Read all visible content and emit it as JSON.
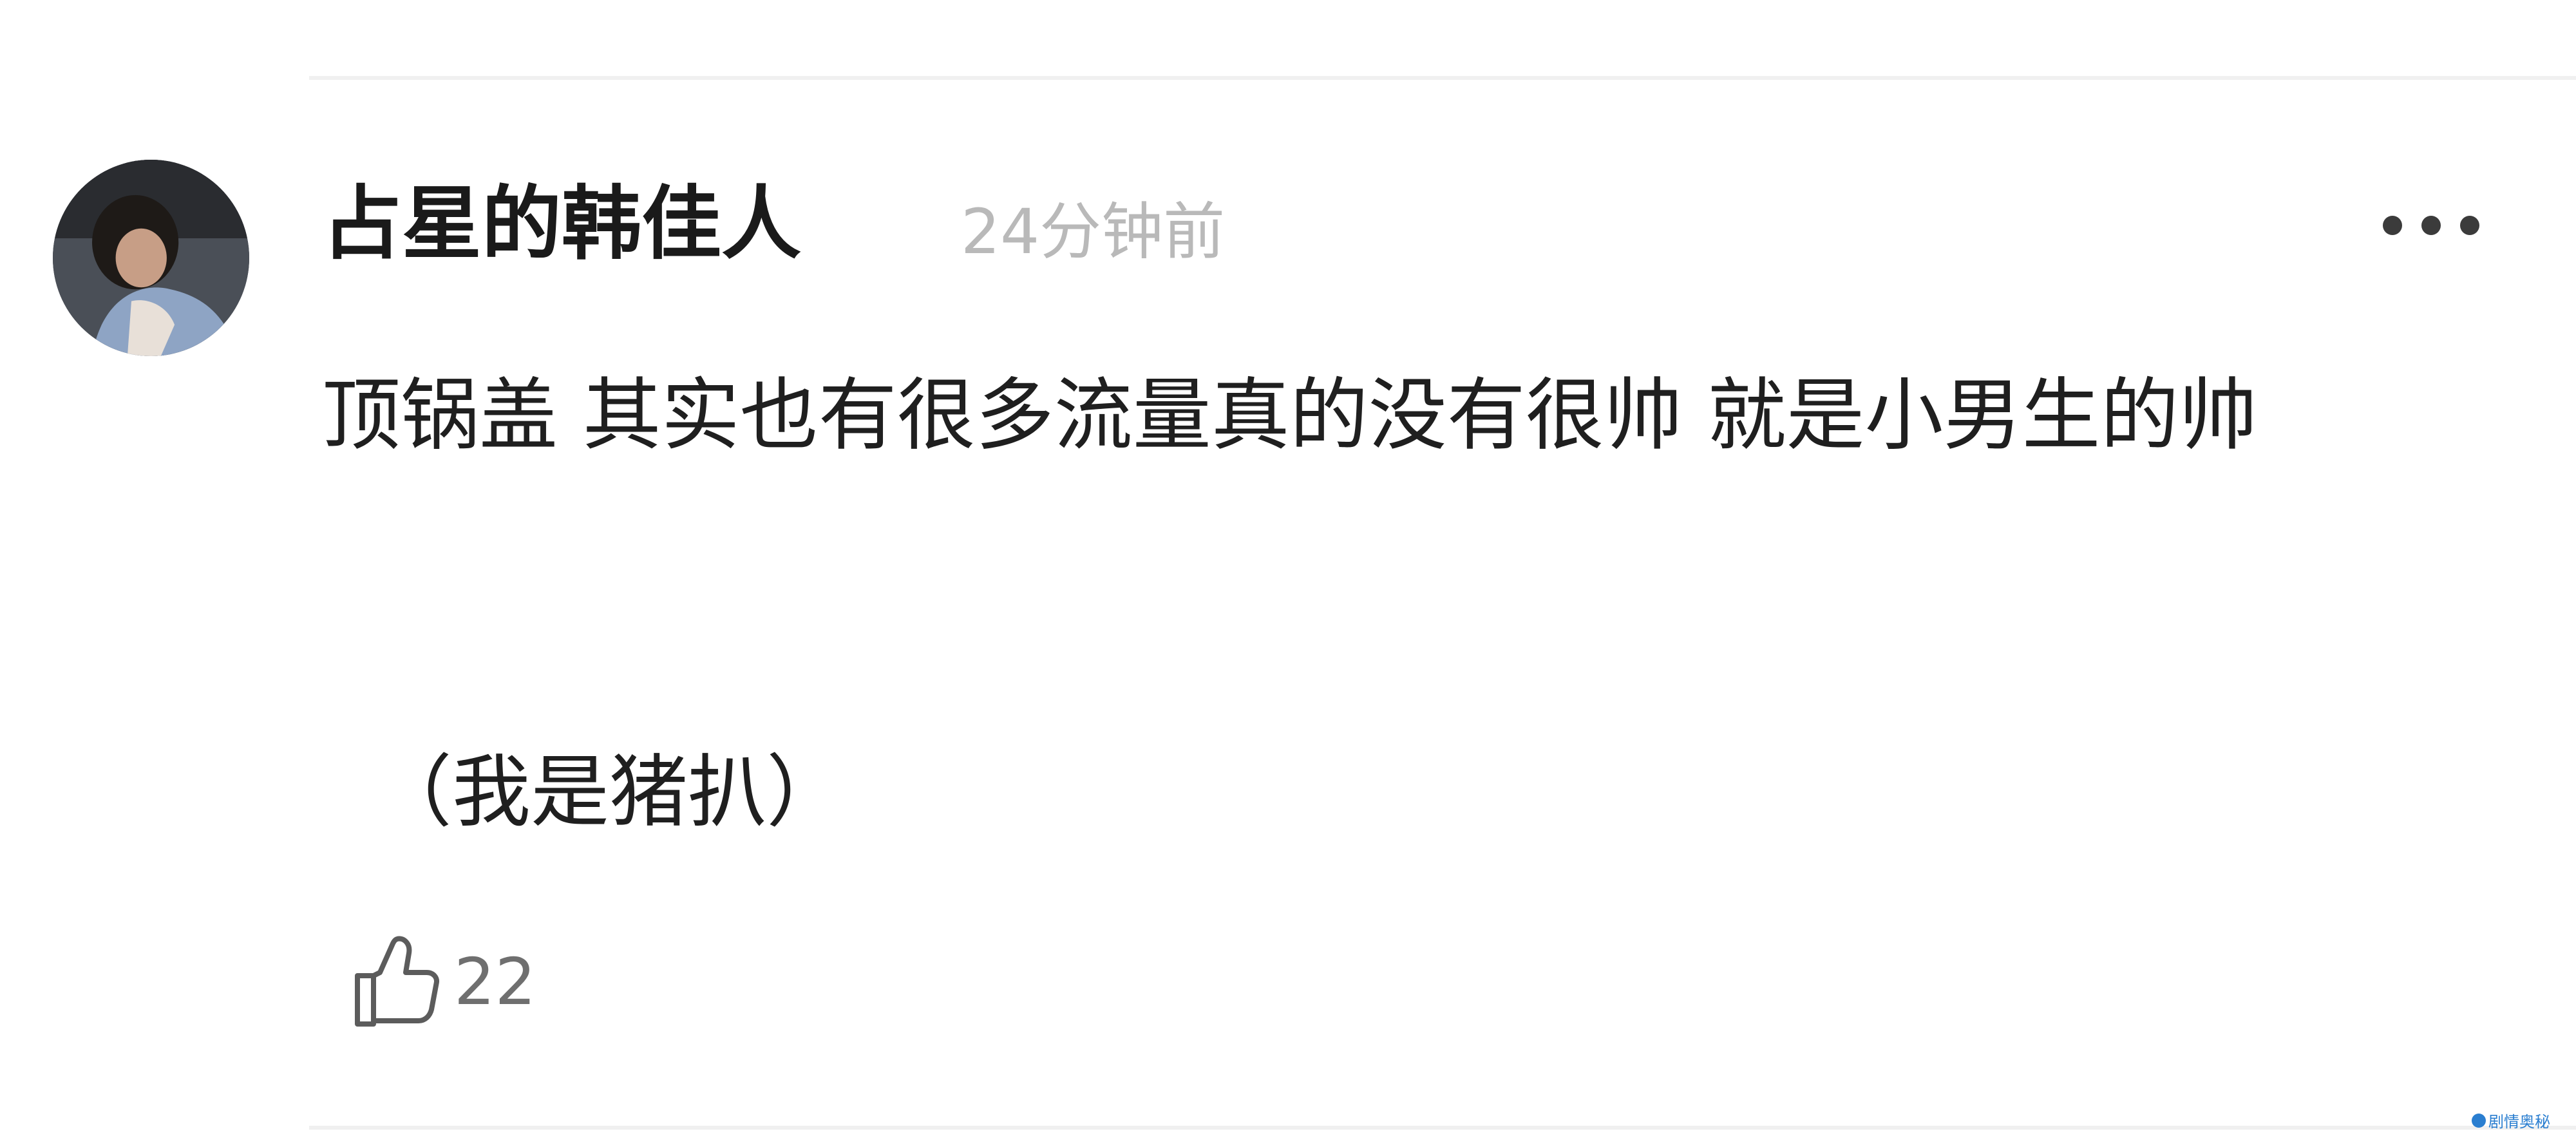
{
  "comment": {
    "username": "占星的韩佳人",
    "timestamp": "24分钟前",
    "body": "顶锅盖 其实也有很多流量真的没有很帅 就是小男生的帅",
    "note": "（我是猪扒）",
    "likes": "22"
  },
  "watermark": {
    "text": "剧情奥秘"
  },
  "icons": {
    "more": "more-horizontal-icon",
    "like": "thumbs-up-icon"
  }
}
